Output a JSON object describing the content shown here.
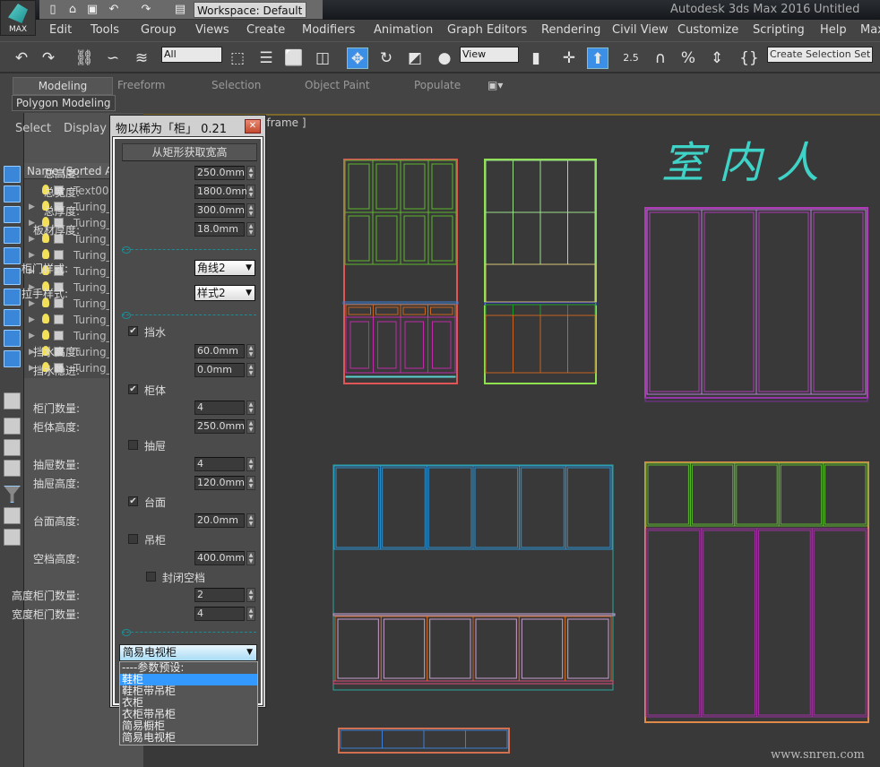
{
  "app": {
    "title": "Autodesk 3ds Max 2016",
    "document": "Untitled",
    "logo_text": "MAX"
  },
  "quick_access": {
    "workspace": "Workspace: Default"
  },
  "menu": [
    "Edit",
    "Tools",
    "Group",
    "Views",
    "Create",
    "Modifiers",
    "Animation",
    "Graph Editors",
    "Rendering",
    "Civil View",
    "Customize",
    "Scripting",
    "Help",
    "Max"
  ],
  "toolbar": {
    "filter": "All",
    "coord_system": "View",
    "snap_angle": "2.5",
    "selection_set_placeholder": "Create Selection Set"
  },
  "ribbon": {
    "tabs": [
      "Modeling",
      "Freeform",
      "Selection",
      "Object Paint",
      "Populate"
    ],
    "active_tab": "Modeling",
    "panel": "Polygon Modeling"
  },
  "scene_explorer": {
    "tabs": [
      "Select",
      "Display"
    ],
    "column_header": "Name (Sorted Ascending)",
    "rows": [
      "Text001",
      "Turing_",
      "Turing_",
      "Turing_",
      "Turing_",
      "Turing_",
      "Turing_",
      "Turing_",
      "Turing_",
      "Turing_",
      "Turing_",
      "Turing_"
    ]
  },
  "viewport": {
    "label": "[ Wireframe ]",
    "watermark": "室内人",
    "site": "www.snren.com"
  },
  "dialog": {
    "title": "物以稀为「柜」 0.21",
    "get_button": "从矩形获取宽高",
    "fields_top": [
      {
        "label": "总高度:",
        "value": "250.0mm"
      },
      {
        "label": "总宽度:",
        "value": "1800.0mm"
      },
      {
        "label": "总厚度:",
        "value": "300.0mm"
      },
      {
        "label": "板材厚度:",
        "value": "18.0mm"
      }
    ],
    "door_style": {
      "label": "柜门样式:",
      "value": "角线2"
    },
    "handle_style": {
      "label": "拉手样式:",
      "value": "样式2"
    },
    "splash": {
      "label": "挡水",
      "checked": true,
      "height_label": "挡水高度:",
      "height": "60.0mm",
      "inset_label": "挡水隐进:",
      "inset": "0.0mm"
    },
    "body": {
      "label": "柜体",
      "checked": true,
      "doors_label": "柜门数量:",
      "doors": "4",
      "height_label": "柜体高度:",
      "height": "250.0mm"
    },
    "drawer": {
      "label": "抽屉",
      "checked": false,
      "count_label": "抽屉数量:",
      "count": "4",
      "height_label": "抽屉高度:",
      "height": "120.0mm"
    },
    "top": {
      "label": "台面",
      "checked": true,
      "height_label": "台面高度:",
      "height": "20.0mm"
    },
    "wall": {
      "label": "吊柜",
      "checked": false,
      "gap_label": "空档高度:",
      "gap": "400.0mm",
      "close_label": "封闭空档",
      "close_checked": false
    },
    "h_doors": {
      "label": "高度柜门数量:",
      "value": "2"
    },
    "w_doors": {
      "label": "宽度柜门数量:",
      "value": "4"
    },
    "preset": {
      "value": "简易电视柜",
      "options": [
        "----参数预设:",
        "鞋柜",
        "鞋柜带吊柜",
        "衣柜",
        "衣柜带吊柜",
        "简易橱柜",
        "简易电视柜"
      ],
      "highlighted": "鞋柜"
    }
  }
}
